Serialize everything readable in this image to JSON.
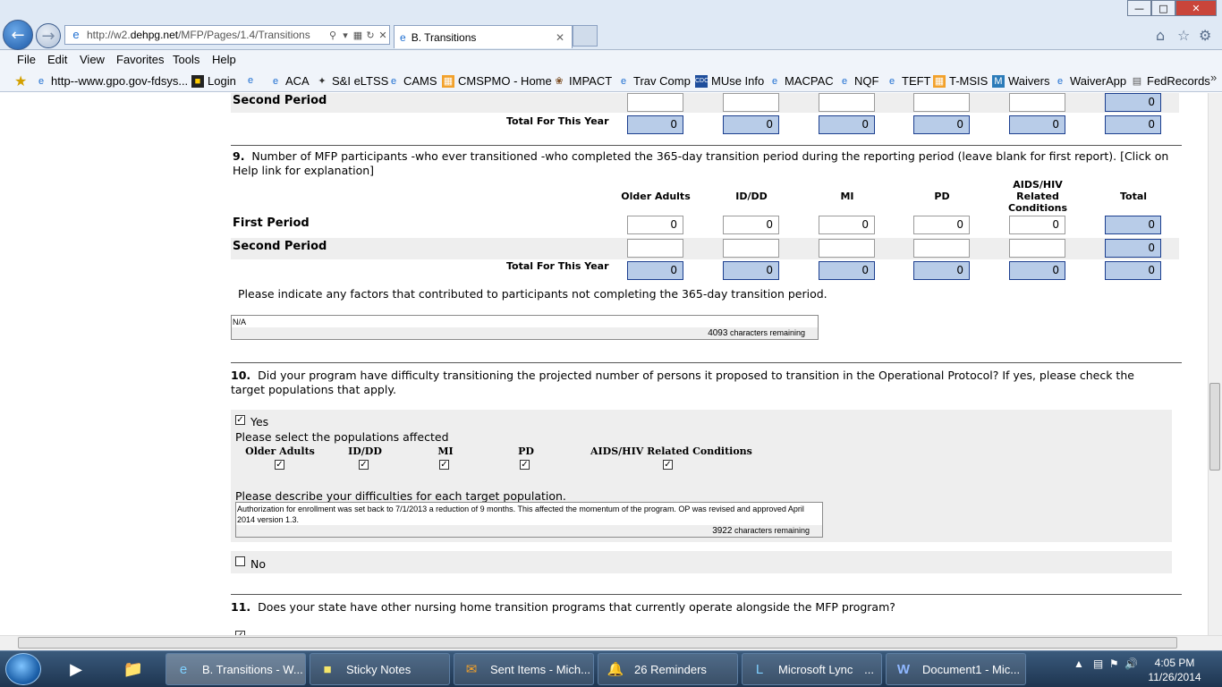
{
  "browser": {
    "address": "http://w2.dehpg.net/MFP/Pages/1.4/Transitions",
    "address_domain": "dehpg.net",
    "address_prefix": "http://w2.",
    "address_suffix": "/MFP/Pages/1.4/Transitions",
    "tab_title": "B. Transitions",
    "menu": [
      "File",
      "Edit",
      "View",
      "Favorites",
      "Tools",
      "Help"
    ],
    "favorites": [
      "http--www.gpo.gov-fdsys...",
      "Login",
      "ACA",
      "S&I eLTSS",
      "CAMS",
      "CMSPMO - Home",
      "IMPACT",
      "Trav Comp",
      "MUse Info",
      "MACPAC",
      "NQF",
      "TEFT",
      "T-MSIS",
      "Waivers",
      "WaiverApp",
      "FedRecords"
    ]
  },
  "page": {
    "columns": [
      "Older Adults",
      "ID/DD",
      "MI",
      "PD",
      "AIDS/HIV Related Conditions",
      "Total"
    ],
    "top_partial": {
      "second_period_label": "Second Period",
      "second_total": "0",
      "total_label": "Total For This Year",
      "totals": [
        "0",
        "0",
        "0",
        "0",
        "0",
        "0"
      ]
    },
    "q9": {
      "number": "9.",
      "text": "Number of MFP participants -who ever transitioned -who completed the 365-day transition period during the reporting period (leave blank for first report). [Click on Help link for explanation]",
      "col_older": "Older Adults",
      "col_iddd": "ID/DD",
      "col_mi": "MI",
      "col_pd": "PD",
      "col_aids_1": "AIDS/HIV",
      "col_aids_2": "Related",
      "col_aids_3": "Conditions",
      "col_total": "Total",
      "first_period_label": "First Period",
      "first_values": [
        "0",
        "0",
        "0",
        "0",
        "0",
        "0"
      ],
      "second_period_label": "Second Period",
      "second_total": "0",
      "total_label": "Total For This Year",
      "totals": [
        "0",
        "0",
        "0",
        "0",
        "0",
        "0"
      ],
      "factors_prompt": "Please indicate any factors that contributed to participants not completing the 365-day transition period.",
      "factors_value": "N/A",
      "factors_remaining_count": "4093",
      "factors_remaining_label": "characters remaining"
    },
    "q10": {
      "number": "10.",
      "text": "Did your program have difficulty transitioning the projected number of persons it proposed to transition in the Operational Protocol? If yes, please check the target populations that apply.",
      "yes_label": "Yes",
      "select_prompt": "Please select the populations affected",
      "populations": [
        "Older Adults",
        "ID/DD",
        "MI",
        "PD",
        "AIDS/HIV Related Conditions"
      ],
      "describe_prompt": "Please describe your difficulties for each target population.",
      "describe_value": "Authorization for enrollment was set back to 7/1/2013 a reduction of 9 months. This affected the momentum of the program. OP was revised and approved April 2014 version 1.3.",
      "describe_remaining_count": "3922",
      "describe_remaining_label": "characters remaining",
      "no_label": "No"
    },
    "q11": {
      "number": "11.",
      "text": "Does your state have other nursing home transition programs that currently operate alongside the MFP program?"
    }
  },
  "taskbar": {
    "tasks": [
      "B. Transitions - W...",
      "Sticky Notes",
      "Sent Items - Mich...",
      "26 Reminders",
      "Microsoft Lync",
      "Document1 - Mic..."
    ],
    "time": "4:05 PM",
    "date": "11/26/2014"
  },
  "colors": {
    "calc_field": "#b8cce8",
    "calc_border": "#1c3f8f",
    "row_shade": "#eeeeee"
  }
}
